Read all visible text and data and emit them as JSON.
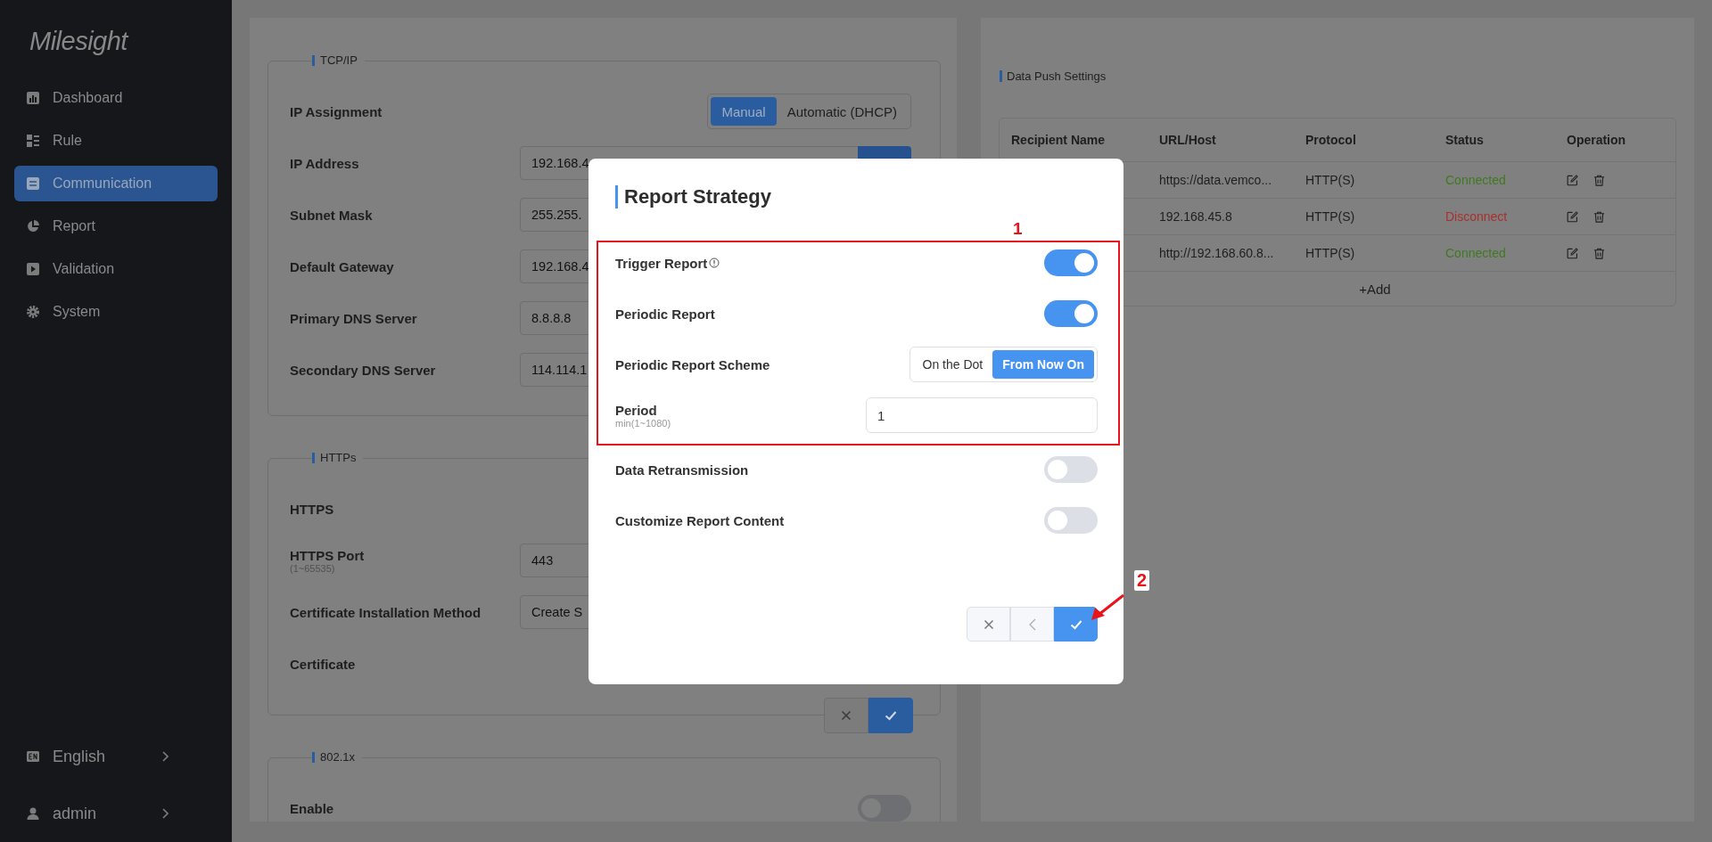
{
  "sidebar": {
    "logo": "Milesight",
    "items": [
      {
        "label": "Dashboard",
        "selected": false
      },
      {
        "label": "Rule",
        "selected": false
      },
      {
        "label": "Communication",
        "selected": true
      },
      {
        "label": "Report",
        "selected": false
      },
      {
        "label": "Validation",
        "selected": false
      },
      {
        "label": "System",
        "selected": false
      }
    ],
    "language": "English",
    "user": "admin"
  },
  "tcp_ip": {
    "title": "TCP/IP",
    "ip_assignment": {
      "label": "IP Assignment",
      "options": [
        {
          "label": "Manual",
          "selected": true
        },
        {
          "label": "Automatic (DHCP)",
          "selected": false
        }
      ]
    },
    "fields": [
      {
        "label": "IP Address",
        "value": "192.168.4",
        "action_button": true
      },
      {
        "label": "Subnet Mask",
        "value": "255.255."
      },
      {
        "label": "Default Gateway",
        "value": "192.168.4"
      },
      {
        "label": "Primary DNS Server",
        "value": "8.8.8.8"
      },
      {
        "label": "Secondary DNS Server",
        "value": "114.114.1"
      }
    ]
  },
  "https": {
    "title": "HTTPs",
    "rows": [
      {
        "kind": "label",
        "label": "HTTPS"
      },
      {
        "kind": "input",
        "label": "HTTPS Port",
        "hint": "(1~65535)",
        "value": "443"
      },
      {
        "kind": "input",
        "label": "Certificate Installation Method",
        "value": "Create S"
      },
      {
        "kind": "label",
        "label": "Certificate"
      }
    ]
  },
  "dot1x": {
    "title": "802.1x",
    "rows": [
      {
        "label": "Enable",
        "on": false
      }
    ]
  },
  "data_push": {
    "title": "Data Push Settings",
    "columns": [
      "Recipient Name",
      "URL/Host",
      "Protocol",
      "Status",
      "Operation"
    ],
    "rows": [
      {
        "url": "https://data.vemco...",
        "protocol": "HTTP(S)",
        "status": "Connected",
        "kind": "connected"
      },
      {
        "url": "192.168.45.8",
        "protocol": "HTTP(S)",
        "status": "Disconnect",
        "kind": "disconnected"
      },
      {
        "url": "http://192.168.60.8...",
        "protocol": "HTTP(S)",
        "status": "Connected",
        "kind": "connected"
      }
    ],
    "add_label": "+Add"
  },
  "modal": {
    "title": "Report Strategy",
    "highlighted_rows": [
      {
        "kind": "toggle",
        "label": "Trigger Report",
        "info": true,
        "on": true
      },
      {
        "kind": "toggle",
        "label": "Periodic Report",
        "info": false,
        "on": true
      },
      {
        "kind": "segmented",
        "label": "Periodic Report Scheme",
        "options": [
          {
            "label": "On the Dot",
            "selected": false
          },
          {
            "label": "From Now On",
            "selected": true
          }
        ]
      },
      {
        "kind": "input",
        "label": "Period",
        "hint": "min(1~1080)",
        "value": "1"
      }
    ],
    "rows": [
      {
        "kind": "toggle",
        "label": "Data Retransmission",
        "info": false,
        "on": false
      },
      {
        "kind": "toggle",
        "label": "Customize Report Content",
        "info": false,
        "on": false
      }
    ]
  },
  "annotations": {
    "highlight_number": "1",
    "arrow_number": "2"
  }
}
